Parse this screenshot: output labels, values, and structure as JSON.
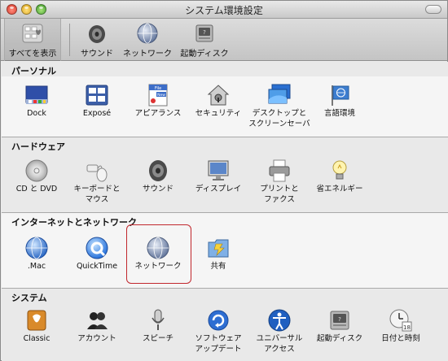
{
  "window": {
    "title": "システム環境設定"
  },
  "toolbar": {
    "items": [
      {
        "label": "すべてを表示",
        "icon": "apple-grid-icon"
      },
      {
        "label": "サウンド",
        "icon": "speaker-icon"
      },
      {
        "label": "ネットワーク",
        "icon": "network-globe-icon"
      },
      {
        "label": "起動ディスク",
        "icon": "hard-disk-icon"
      }
    ]
  },
  "sections": [
    {
      "title": "パーソナル",
      "panes": [
        {
          "label": "Dock",
          "icon": "dock-icon"
        },
        {
          "label": "Exposé",
          "icon": "expose-icon"
        },
        {
          "label": "アピアランス",
          "icon": "appearance-icon"
        },
        {
          "label": "セキュリティ",
          "icon": "security-house-icon"
        },
        {
          "label": "デスクトップと\nスクリーンセーバ",
          "icon": "desktop-icon"
        },
        {
          "label": "言語環境",
          "icon": "international-flag-icon"
        }
      ]
    },
    {
      "title": "ハードウェア",
      "panes": [
        {
          "label": "CD と DVD",
          "icon": "cd-icon"
        },
        {
          "label": "キーボードと\nマウス",
          "icon": "keyboard-mouse-icon"
        },
        {
          "label": "サウンド",
          "icon": "speaker-icon"
        },
        {
          "label": "ディスプレイ",
          "icon": "display-icon"
        },
        {
          "label": "プリントと\nファクス",
          "icon": "printer-icon"
        },
        {
          "label": "省エネルギー",
          "icon": "lightbulb-icon"
        }
      ]
    },
    {
      "title": "インターネットとネットワーク",
      "panes": [
        {
          "label": ".Mac",
          "icon": "dotmac-globe-icon"
        },
        {
          "label": "QuickTime",
          "icon": "quicktime-icon"
        },
        {
          "label": "ネットワーク",
          "icon": "network-globe-icon"
        },
        {
          "label": "共有",
          "icon": "sharing-folder-icon"
        }
      ]
    },
    {
      "title": "システム",
      "panes": [
        {
          "label": "Classic",
          "icon": "classic-icon"
        },
        {
          "label": "アカウント",
          "icon": "accounts-icon"
        },
        {
          "label": "スピーチ",
          "icon": "microphone-icon"
        },
        {
          "label": "ソフトウェア\nアップデート",
          "icon": "software-update-icon"
        },
        {
          "label": "ユニバーサル\nアクセス",
          "icon": "universal-access-icon"
        },
        {
          "label": "起動ディスク",
          "icon": "hard-disk-icon"
        },
        {
          "label": "日付と時刻",
          "icon": "clock-icon"
        }
      ]
    }
  ],
  "colors": {
    "highlight": "#c1272d"
  }
}
